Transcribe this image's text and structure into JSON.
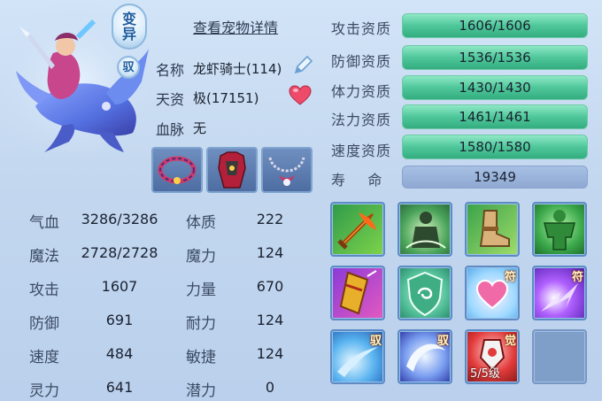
{
  "pet": {
    "badge_bianyi": "变\n异",
    "badge_yu": "驭",
    "detail_link": "查看宠物详情",
    "name_label": "名称",
    "name_value": "龙虾骑士(114)",
    "talent_label": "天资",
    "talent_value": "极(17151)",
    "blood_label": "血脉",
    "blood_value": "无"
  },
  "equipment": [
    {
      "name": "collar-equipment"
    },
    {
      "name": "armor-equipment"
    },
    {
      "name": "necklace-equipment"
    }
  ],
  "stats_left": [
    {
      "label": "气血",
      "value": "3286/3286"
    },
    {
      "label": "魔法",
      "value": "2728/2728"
    },
    {
      "label": "攻击",
      "value": "1607"
    },
    {
      "label": "防御",
      "value": "691"
    },
    {
      "label": "速度",
      "value": "484"
    },
    {
      "label": "灵力",
      "value": "641"
    }
  ],
  "stats_right": [
    {
      "label": "体质",
      "value": "222"
    },
    {
      "label": "魔力",
      "value": "124"
    },
    {
      "label": "力量",
      "value": "670"
    },
    {
      "label": "耐力",
      "value": "124"
    },
    {
      "label": "敏捷",
      "value": "124"
    },
    {
      "label": "潜力",
      "value": "0"
    }
  ],
  "aptitudes": [
    {
      "label": "攻击资质",
      "value": "1606/1606"
    },
    {
      "label": "防御资质",
      "value": "1536/1536"
    },
    {
      "label": "体力资质",
      "value": "1430/1430"
    },
    {
      "label": "法力资质",
      "value": "1461/1461"
    },
    {
      "label": "速度资质",
      "value": "1580/1580"
    }
  ],
  "life": {
    "label": "寿    命",
    "value": "19349"
  },
  "skills": [
    {
      "icon": "flaming-sword-icon",
      "tag": ""
    },
    {
      "icon": "shadow-warrior-icon",
      "tag": ""
    },
    {
      "icon": "swift-boot-icon",
      "tag": ""
    },
    {
      "icon": "green-giant-icon",
      "tag": ""
    },
    {
      "icon": "golden-blade-icon",
      "tag": ""
    },
    {
      "icon": "shield-rune-icon",
      "tag": ""
    },
    {
      "icon": "heart-sparkle-icon",
      "tag": "符"
    },
    {
      "icon": "purple-burst-icon",
      "tag": "符"
    },
    {
      "icon": "blue-slash-icon",
      "tag": "驭"
    },
    {
      "icon": "crescent-arc-icon",
      "tag": "驭"
    },
    {
      "icon": "awaken-red-icon",
      "tag": "觉",
      "level": "5/5级"
    },
    {
      "icon": "empty-slot",
      "tag": ""
    }
  ]
}
